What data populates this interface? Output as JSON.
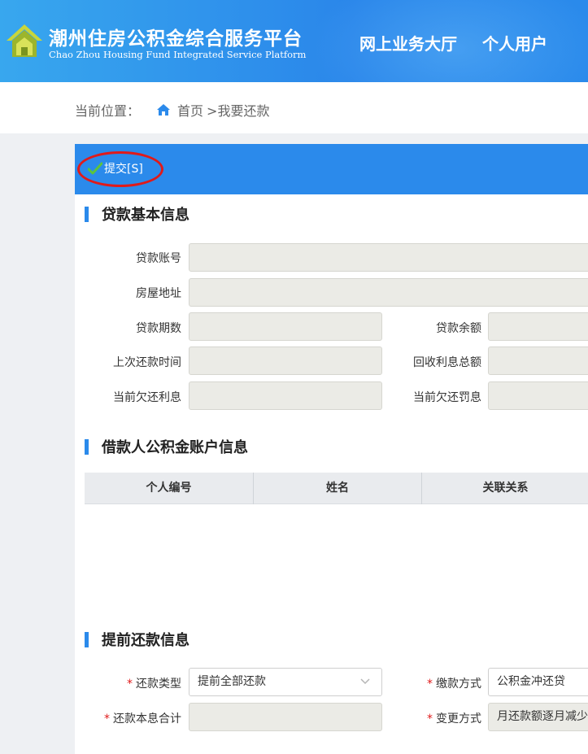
{
  "header": {
    "title": "潮州住房公积金综合服务平台",
    "subtitle": "Chao Zhou Housing Fund Integrated Service Platform",
    "nav": [
      "网上业务大厅",
      "个人用户"
    ]
  },
  "breadcrumb": {
    "prefix": "当前位置：",
    "home": "首页",
    "current": ">我要还款"
  },
  "toolbar": {
    "submit_label": "提交[S]"
  },
  "loan_section": {
    "title": "贷款基本信息",
    "fields": {
      "loan_account": {
        "label": "贷款账号",
        "value": ""
      },
      "house_address": {
        "label": "房屋地址",
        "value": ""
      },
      "loan_term": {
        "label": "贷款期数",
        "value": ""
      },
      "loan_balance": {
        "label": "贷款余额",
        "value": ""
      },
      "last_repay_time": {
        "label": "上次还款时间",
        "value": ""
      },
      "total_interest": {
        "label": "回收利息总额",
        "value": ""
      },
      "owed_interest": {
        "label": "当前欠还利息",
        "value": ""
      },
      "owed_penalty": {
        "label": "当前欠还罚息",
        "value": ""
      }
    }
  },
  "borrower_section": {
    "title": "借款人公积金账户信息",
    "columns": [
      "个人编号",
      "姓名",
      "关联关系"
    ],
    "rows": []
  },
  "prepay_section": {
    "title": "提前还款信息",
    "repay_type": {
      "label": "还款类型",
      "value": "提前全部还款"
    },
    "pay_method": {
      "label": "缴款方式",
      "value": "公积金冲还贷"
    },
    "total_principal_interest": {
      "label": "还款本息合计",
      "value": ""
    },
    "change_method": {
      "label": "变更方式",
      "value": "月还款额逐月减少"
    },
    "required_mark": "*"
  },
  "colors": {
    "accent": "#2b8aeb",
    "required": "#e01a1a",
    "readonly_field": "#ebebe6"
  }
}
